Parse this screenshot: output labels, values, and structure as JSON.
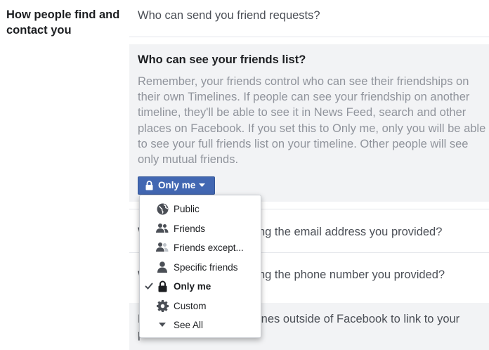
{
  "section": {
    "title": "How people find and contact you"
  },
  "rows": {
    "friend_requests": "Who can send you friend requests?",
    "friends_list": {
      "title": "Who can see your friends list?",
      "description": "Remember, your friends control who can see their friendships on their own Timelines. If people can see your friendship on another timeline, they'll be able to see it in News Feed, search and other places on Facebook. If you set this to Only me, only you will be able to see your full friends list on your timeline. Other people will see only mutual friends."
    },
    "email_lookup": {
      "lead": "W",
      "tail": "ng the email address you provided?"
    },
    "phone_lookup": {
      "lead": "W",
      "tail": "ng the phone number you provided?"
    },
    "search_engines": {
      "lead": "D",
      "tail_1": "ines outside of Facebook to link to your",
      "tail_2": "profile?"
    }
  },
  "selector": {
    "label": "Only me",
    "icon": "lock-icon"
  },
  "menu": {
    "items": [
      {
        "label": "Public",
        "icon": "globe-icon",
        "selected": false
      },
      {
        "label": "Friends",
        "icon": "friends-icon",
        "selected": false
      },
      {
        "label": "Friends except...",
        "icon": "friends-except-icon",
        "selected": false
      },
      {
        "label": "Specific friends",
        "icon": "person-icon",
        "selected": false
      },
      {
        "label": "Only me",
        "icon": "lock-icon",
        "selected": true
      },
      {
        "label": "Custom",
        "icon": "gear-icon",
        "selected": false
      },
      {
        "label": "See All",
        "icon": "caret-down-icon",
        "selected": false
      }
    ]
  },
  "colors": {
    "accent": "#4267b2",
    "panel_bg": "#f2f3f5",
    "muted_text": "#90949c"
  }
}
